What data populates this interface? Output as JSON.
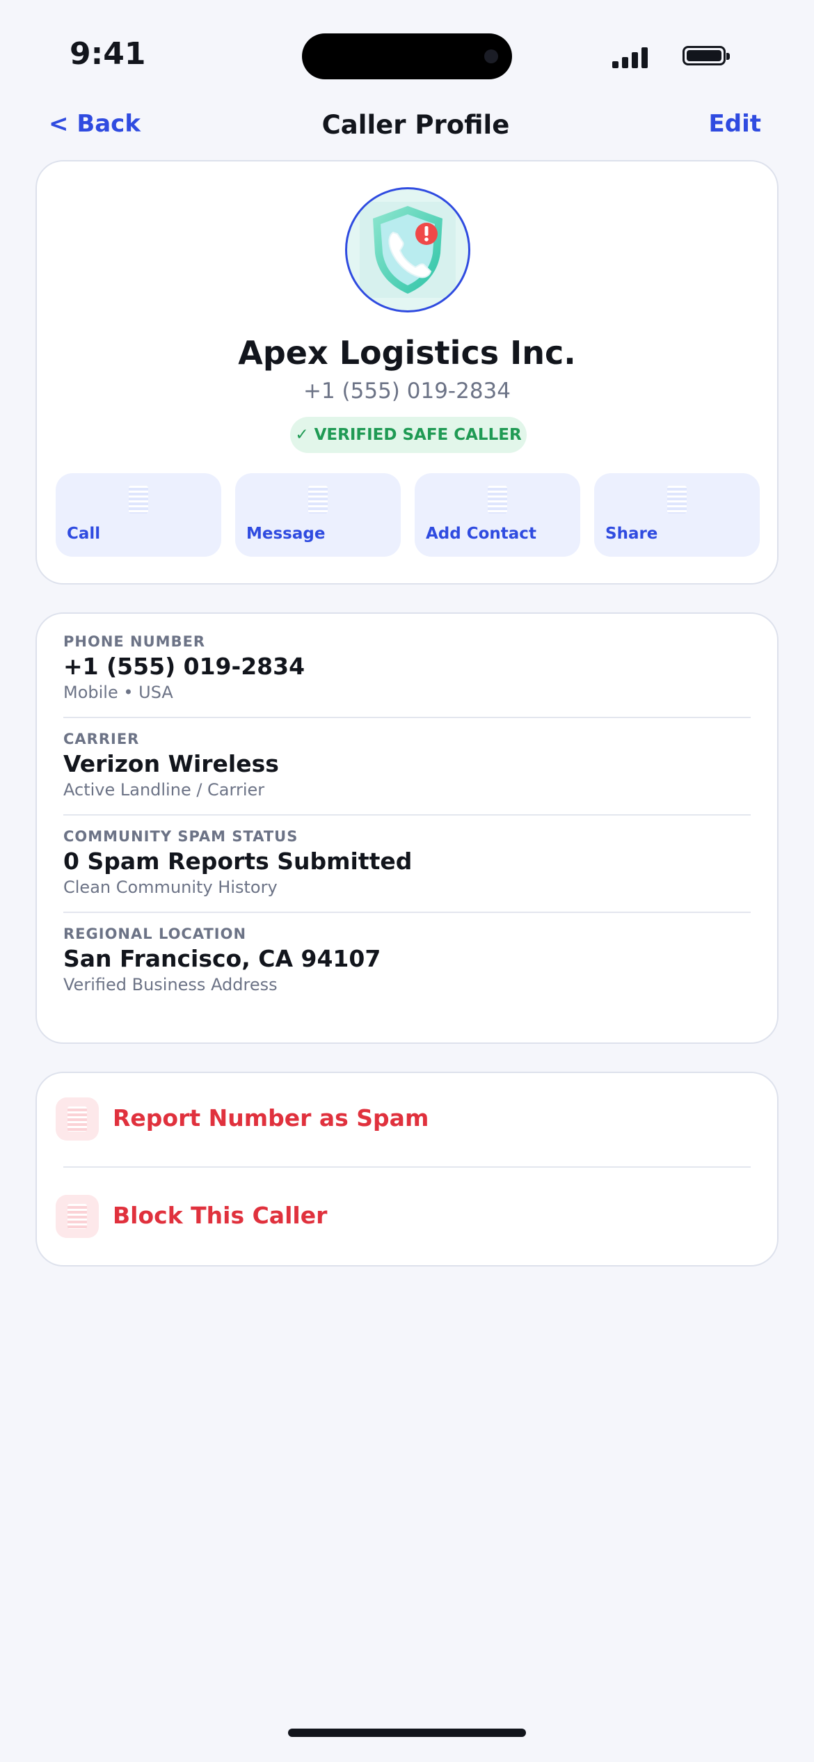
{
  "status_bar": {
    "time": "9:41"
  },
  "nav": {
    "back": "< Back",
    "title": "Caller Profile",
    "edit": "Edit"
  },
  "profile": {
    "avatar_icon": "shield-phone-alert-icon",
    "name": "Apex Logistics Inc.",
    "phone": "+1 (555) 019-2834",
    "badge": "✓ VERIFIED SAFE CALLER",
    "actions": [
      {
        "label": "Call",
        "icon": "phone-icon"
      },
      {
        "label": "Message",
        "icon": "message-icon"
      },
      {
        "label": "Add Contact",
        "icon": "add-contact-icon"
      },
      {
        "label": "Share",
        "icon": "share-icon"
      }
    ]
  },
  "details": [
    {
      "label": "PHONE NUMBER",
      "value": "+1 (555) 019-2834",
      "sub": "Mobile • USA"
    },
    {
      "label": "CARRIER",
      "value": "Verizon Wireless",
      "sub": "Active Landline / Carrier"
    },
    {
      "label": "COMMUNITY SPAM STATUS",
      "value": "0 Spam Reports Submitted",
      "sub": "Clean Community History"
    },
    {
      "label": "REGIONAL LOCATION",
      "value": "San Francisco, CA 94107",
      "sub": "Verified Business Address"
    }
  ],
  "danger_actions": [
    {
      "label": "Report Number as Spam",
      "icon": "report-icon"
    },
    {
      "label": "Block This Caller",
      "icon": "block-icon"
    }
  ],
  "colors": {
    "accent": "#2f4be0",
    "danger": "#e0313d",
    "success": "#1f9a54",
    "background": "#f5f6fb"
  }
}
